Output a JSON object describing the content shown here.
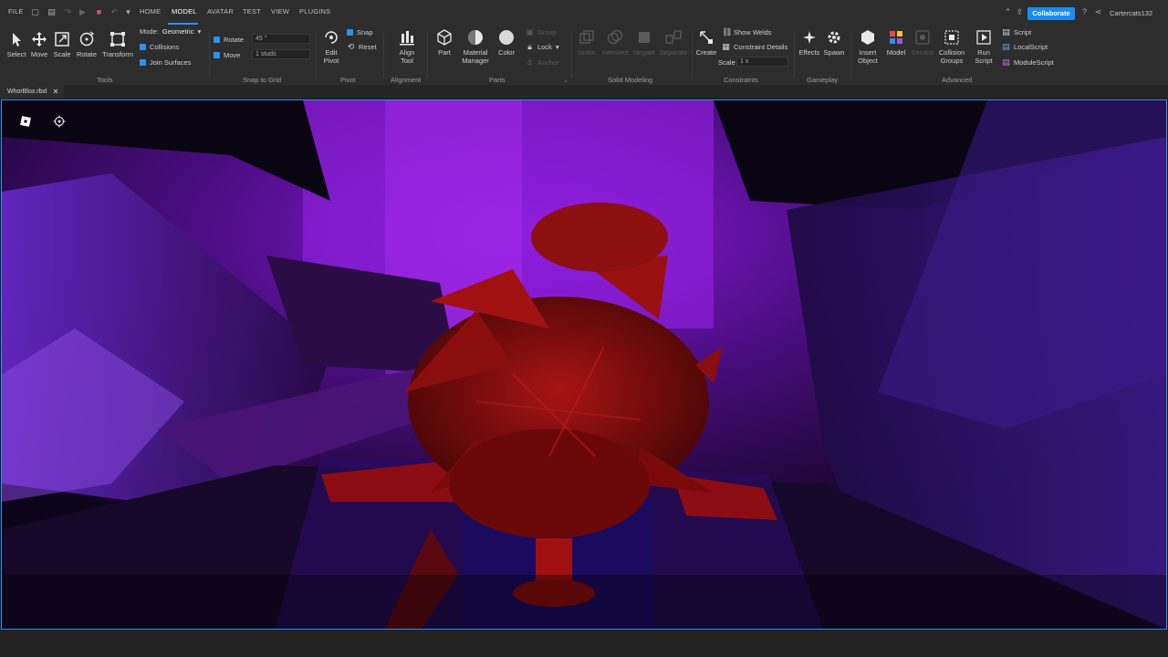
{
  "menubar": {
    "file": "FILE",
    "tabs": [
      "HOME",
      "MODEL",
      "AVATAR",
      "TEST",
      "VIEW",
      "PLUGINS"
    ],
    "active_tab": "MODEL",
    "collaborate": "Collaborate",
    "username": "Cartercats132"
  },
  "tools": {
    "select": "Select",
    "move": "Move",
    "scale": "Scale",
    "rotate": "Rotate",
    "transform": "Transform",
    "group_label": "Tools",
    "mode_label": "Mode:",
    "mode_value": "Geometric",
    "collisions": "Collisions",
    "join_surfaces": "Join Surfaces"
  },
  "snap": {
    "rotate_label": "Rotate",
    "rotate_value": "45 °",
    "move_label": "Move",
    "move_value": "1 studs",
    "group_label": "Snap to Grid"
  },
  "pivot": {
    "edit_pivot": "Edit Pivot",
    "snap": "Snap",
    "reset": "Reset",
    "group_label": "Pivot"
  },
  "alignment": {
    "align_tool": "Align Tool",
    "group_label": "Alignment"
  },
  "parts": {
    "part": "Part",
    "material_manager": "Material Manager",
    "color": "Color",
    "group": "Group",
    "lock": "Lock",
    "anchor": "Anchor",
    "group_label": "Parts"
  },
  "solid": {
    "union": "Union",
    "intersect": "Intersect",
    "negate": "Negate",
    "separate": "Separate",
    "group_label": "Solid Modeling"
  },
  "constraints": {
    "create": "Create",
    "show_welds": "Show Welds",
    "constraint_details": "Constraint Details",
    "scale_label": "Scale",
    "scale_value": "1 x",
    "group_label": "Constraints"
  },
  "gameplay": {
    "effects": "Effects",
    "spawn": "Spawn",
    "group_label": "Gameplay"
  },
  "advanced": {
    "insert_object": "Insert Object",
    "model": "Model",
    "service": "Service",
    "collision_groups": "Collision Groups",
    "run_script": "Run Script",
    "script": "Script",
    "local_script": "LocalScript",
    "module_script": "ModuleScript",
    "group_label": "Advanced"
  },
  "file_tab": {
    "name": "WhorBlox.rbxl"
  },
  "colors": {
    "accent": "#2f8ff0",
    "ribbon_bg": "#2d2d2d",
    "scene_purple": "#7a14c8",
    "scene_red": "#a01010"
  }
}
